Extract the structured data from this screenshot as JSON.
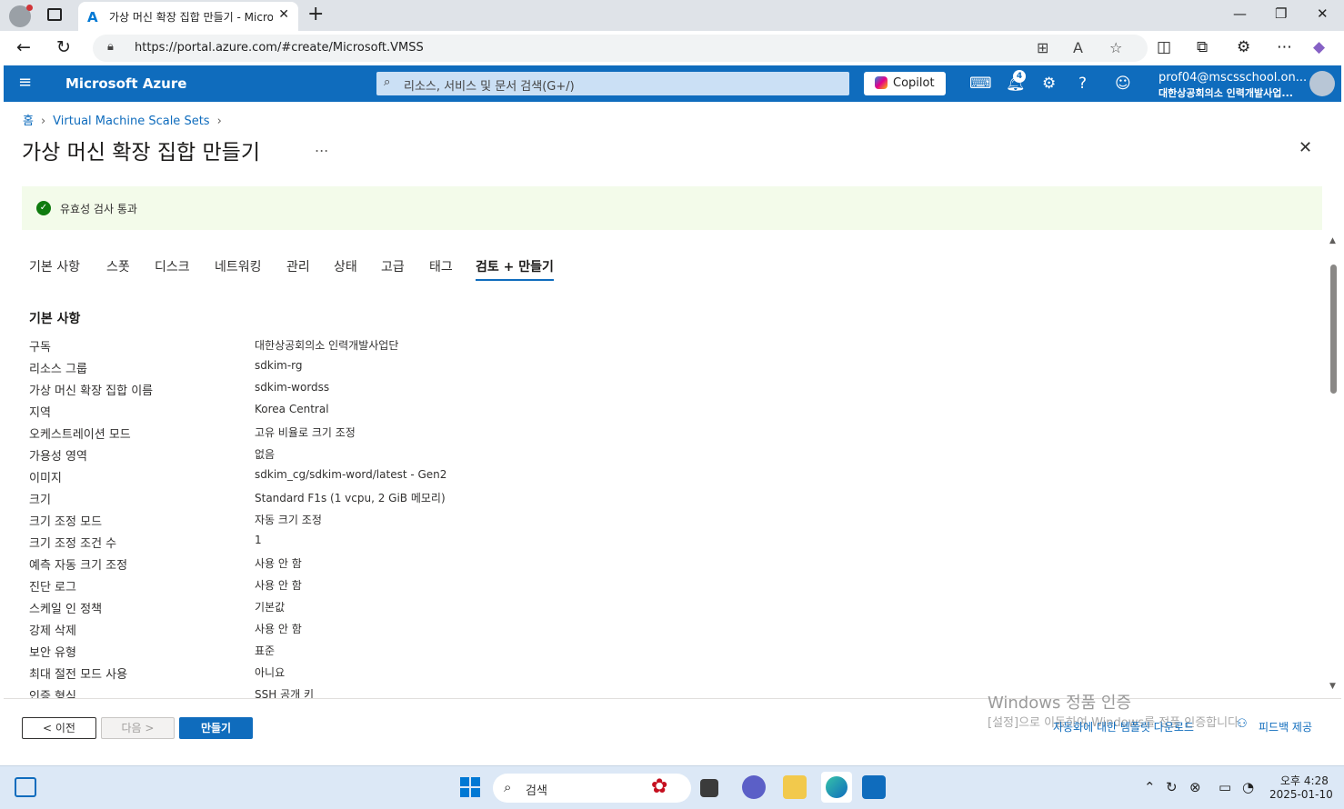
{
  "browser": {
    "tab_title": "가상 머신 확장 집합 만들기 - Microsoft Azure",
    "url": "https://portal.azure.com/#create/Microsoft.VMSS"
  },
  "azure": {
    "brand": "Microsoft Azure",
    "search_placeholder": "리소스, 서비스 및 문서 검색(G+/)",
    "copilot_label": "Copilot",
    "notification_count": "4",
    "account_name": "prof04@mscsschool.on...",
    "account_org": "대한상공회의소 인력개발사업..."
  },
  "breadcrumb": [
    "홈",
    "Virtual Machine Scale Sets"
  ],
  "page": {
    "title": "가상 머신 확장 집합 만들기",
    "more": "...",
    "validation": "유효성 검사 통과"
  },
  "tabs": [
    "기본 사항",
    "스폿",
    "디스크",
    "네트워킹",
    "관리",
    "상태",
    "고급",
    "태그",
    "검토 + 만들기"
  ],
  "active_tab": "검토 + 만들기",
  "section_title": "기본 사항",
  "review_rows": [
    {
      "label": "구독",
      "value": "대한상공회의소 인력개발사업단"
    },
    {
      "label": "리소스 그룹",
      "value": "sdkim-rg"
    },
    {
      "label": "가상 머신 확장 집합 이름",
      "value": "sdkim-wordss"
    },
    {
      "label": "지역",
      "value": "Korea Central"
    },
    {
      "label": "오케스트레이션 모드",
      "value": "고유 비율로 크기 조정"
    },
    {
      "label": "가용성 영역",
      "value": "없음"
    },
    {
      "label": "이미지",
      "value": "sdkim_cg/sdkim-word/latest - Gen2"
    },
    {
      "label": "크기",
      "value": "Standard F1s (1 vcpu, 2 GiB 메모리)"
    },
    {
      "label": "크기 조정 모드",
      "value": "자동 크기 조정"
    },
    {
      "label": "크기 조정 조건 수",
      "value": "1"
    },
    {
      "label": "예측 자동 크기 조정",
      "value": "사용 안 함"
    },
    {
      "label": "진단 로그",
      "value": "사용 안 함"
    },
    {
      "label": "스케일 인 정책",
      "value": "기본값"
    },
    {
      "label": "강제 삭제",
      "value": "사용 안 함"
    },
    {
      "label": "보안 유형",
      "value": "표준"
    },
    {
      "label": "최대 절전 모드 사용",
      "value": "아니요"
    },
    {
      "label": "인증 형식",
      "value": "SSH 공개 키"
    }
  ],
  "footer": {
    "prev": "< 이전",
    "next": "다음 >",
    "create": "만들기",
    "template_link": "자동화에 대한 템플릿 다운로드",
    "feedback": "피드백 제공"
  },
  "watermark": {
    "title": "Windows 정품 인증",
    "subtitle": "[설정]으로 이동하여 Windows를 정품 인증합니다."
  },
  "taskbar": {
    "search": "검색",
    "time": "오후 4:28",
    "date": "2025-01-10"
  },
  "colors": {
    "azure_blue": "#0f6cbd",
    "success_green": "#0f7b0f",
    "banner_bg": "#f3fbea"
  }
}
